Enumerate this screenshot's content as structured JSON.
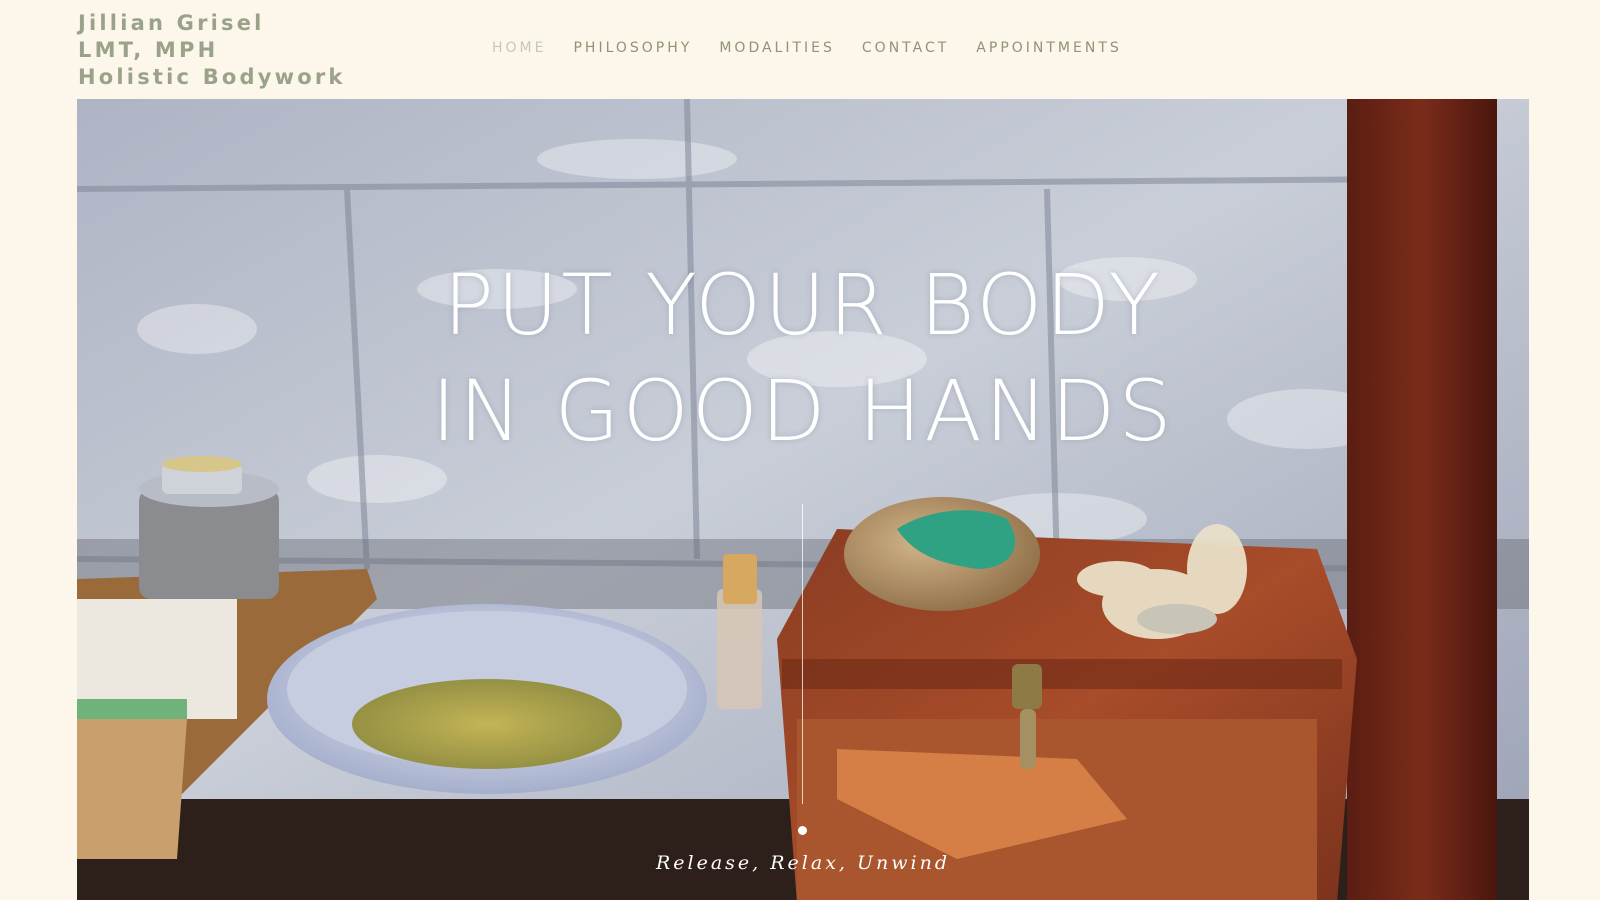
{
  "brand": {
    "line1": "Jillian Grisel",
    "line2": "LMT, MPH",
    "line3": "Holistic Bodywork",
    "color": "#9aa38a"
  },
  "nav": {
    "items": [
      {
        "label": "HOME",
        "active": true
      },
      {
        "label": "PHILOSOPHY",
        "active": false
      },
      {
        "label": "MODALITIES",
        "active": false
      },
      {
        "label": "CONTACT",
        "active": false
      },
      {
        "label": "APPOINTMENTS",
        "active": false
      }
    ]
  },
  "hero": {
    "headline_line1": "PUT YOUR BODY",
    "headline_line2": "IN GOOD HANDS",
    "tagline": "Release, Relax, Unwind"
  },
  "colors": {
    "background": "#fdf6ea",
    "nav_text": "#8e9478",
    "nav_active": "#c4c9b4",
    "hero_text": "#ffffff"
  }
}
